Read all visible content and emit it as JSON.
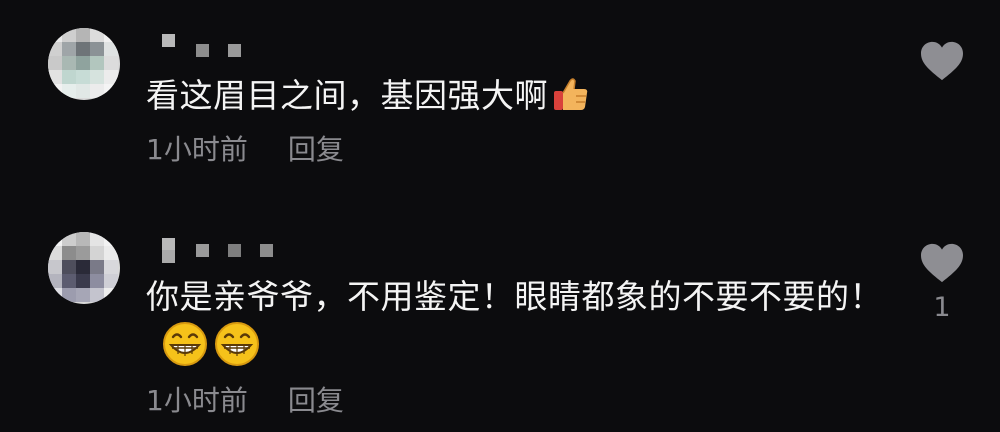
{
  "comments": [
    {
      "text": "看这眉目之间，基因强大啊",
      "emoji": "thumbs-up",
      "time": "1小时前",
      "reply_label": "回复",
      "likes": ""
    },
    {
      "text": "你是亲爷爷，不用鉴定！眼睛都象的不要不要的！",
      "emoji": "grinning-face-x2",
      "time": "1小时前",
      "reply_label": "回复",
      "likes": "1"
    }
  ],
  "colors": {
    "background": "#0c0c0e",
    "text": "#f4f4f4",
    "meta": "#8a8a8f",
    "heart": "#8e8e93"
  }
}
